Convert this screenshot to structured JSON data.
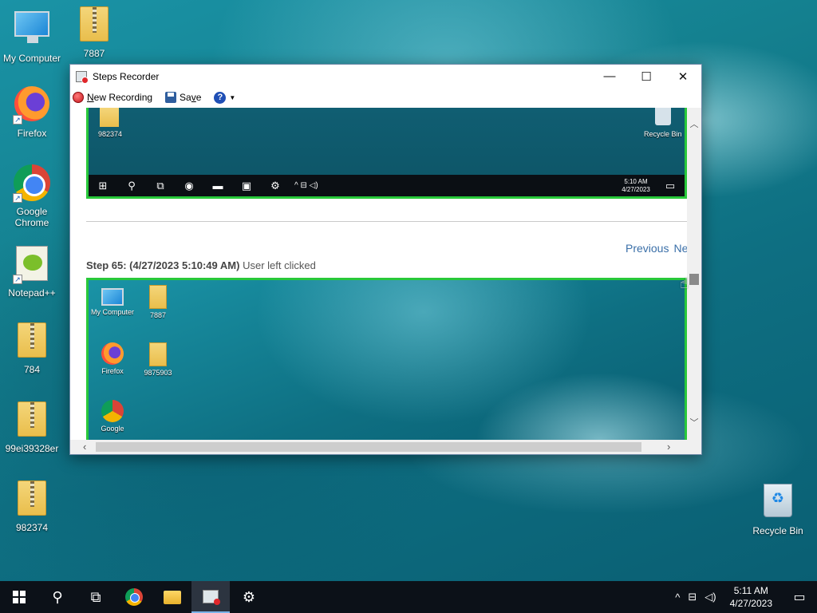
{
  "desktop": {
    "icons": [
      {
        "label": "My Computer"
      },
      {
        "label": "7887"
      },
      {
        "label": "Firefox"
      },
      {
        "label": "Google Chrome"
      },
      {
        "label": "Notepad++"
      },
      {
        "label": "784"
      },
      {
        "label": "99ei39328er"
      },
      {
        "label": "982374"
      },
      {
        "label": "Recycle Bin"
      }
    ]
  },
  "window": {
    "title": "Steps Recorder",
    "controls": {
      "minimize": "—",
      "maximize": "☐",
      "close": "✕"
    },
    "toolbar": {
      "new_recording_accel": "N",
      "new_recording_rest": "ew Recording",
      "save_pre": "Sa",
      "save_accel": "v",
      "save_post": "e",
      "help_glyph": "?",
      "help_caret": "▼"
    },
    "prev_shot": {
      "icon_label_left": "982374",
      "icon_label_right": "Recycle Bin",
      "clock_time": "5:10 AM",
      "clock_date": "4/27/2023"
    },
    "nav": {
      "previous": "Previous",
      "next": "Next"
    },
    "step": {
      "header": "Step 65: (4/27/2023 5:10:49 AM)",
      "action": "User left clicked"
    },
    "current_shot": {
      "icons": [
        {
          "label": "My Computer"
        },
        {
          "label": "7887"
        },
        {
          "label": "Firefox"
        },
        {
          "label": "9875903"
        },
        {
          "label": "Google"
        }
      ]
    }
  },
  "taskbar": {
    "clock_time": "5:11 AM",
    "clock_date": "4/27/2023"
  }
}
